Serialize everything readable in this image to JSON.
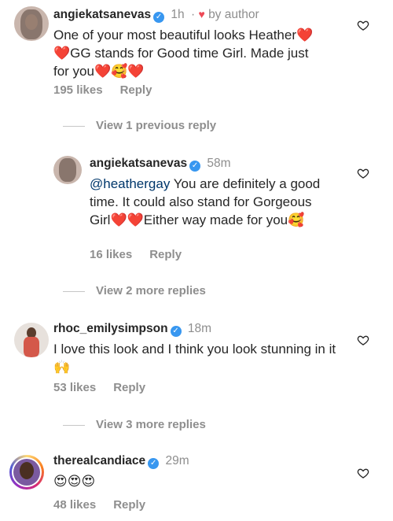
{
  "comments": [
    {
      "username": "angiekatsanevas",
      "time": "1h",
      "separator": "·",
      "badge_text": "by author",
      "text_parts": [
        "One of your most beautiful looks Heather",
        "❤️❤️",
        "GG stands for Good time Girl. Made just for you",
        "❤️🥰❤️"
      ],
      "likes": "195 likes",
      "reply": "Reply"
    },
    {
      "view_replies": "View 1 previous reply"
    },
    {
      "username": "angiekatsanevas",
      "time": "58m",
      "mention": "@heathergay",
      "text_parts": [
        " You are definitely a good time. It could also stand for Gorgeous Girl",
        "❤️❤️",
        "Either way made for you",
        "🥰"
      ],
      "likes": "16 likes",
      "reply": "Reply"
    },
    {
      "view_replies": "View 2 more replies"
    },
    {
      "username": "rhoc_emilysimpson",
      "time": "18m",
      "text_parts": [
        "I love this look and I think you look stunning in it ",
        "🙌"
      ],
      "likes": "53 likes",
      "reply": "Reply"
    },
    {
      "view_replies": "View 3 more replies"
    },
    {
      "username": "therealcandiace",
      "time": "29m",
      "text_parts": [
        "😍😍😍"
      ],
      "likes": "48 likes",
      "reply": "Reply"
    }
  ],
  "icons": {
    "verified": "✓",
    "like": "heart-outline-icon",
    "badge_heart": "♥"
  }
}
